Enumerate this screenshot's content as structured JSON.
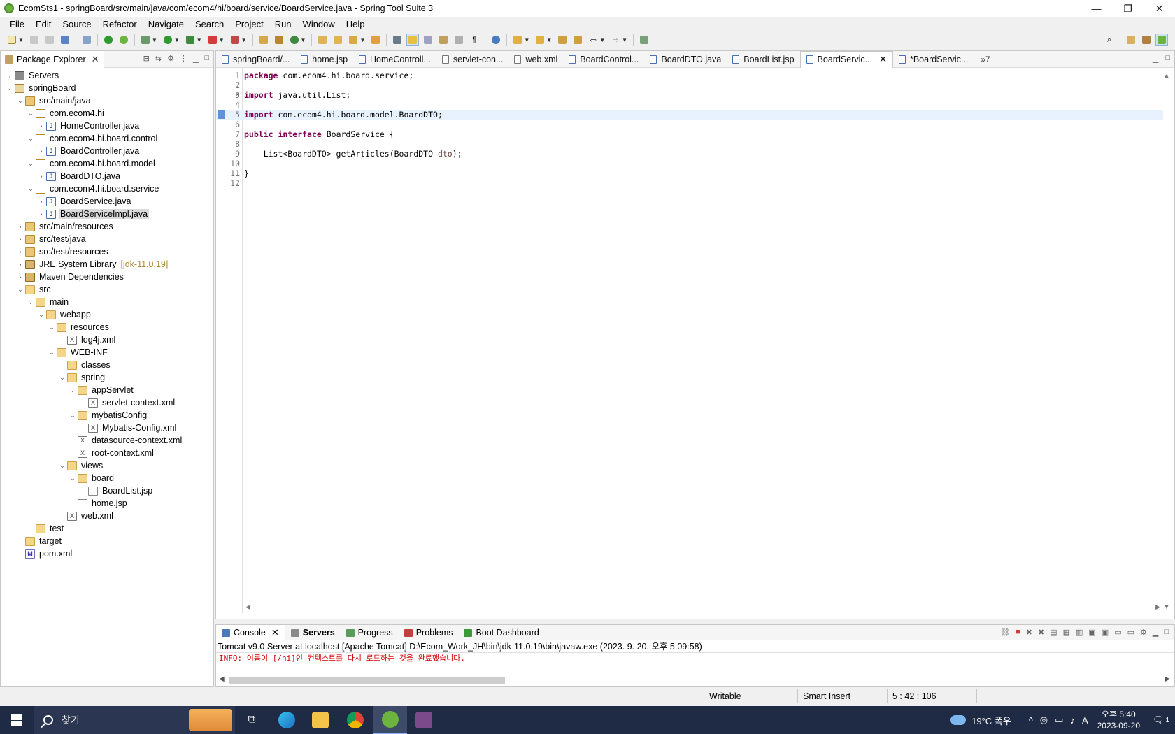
{
  "window": {
    "title": "EcomSts1 - springBoard/src/main/java/com/ecom4/hi/board/service/BoardService.java - Spring Tool Suite 3",
    "min_label": "—",
    "max_label": "❐",
    "close_label": "✕"
  },
  "menu": [
    "File",
    "Edit",
    "Source",
    "Refactor",
    "Navigate",
    "Search",
    "Project",
    "Run",
    "Window",
    "Help"
  ],
  "package_explorer": {
    "tab_label": "Package Explorer",
    "tree": [
      {
        "label": "Servers",
        "icon": "server",
        "depth": 0,
        "twisty": "›"
      },
      {
        "label": "springBoard",
        "icon": "proj",
        "depth": 0,
        "twisty": "⌄"
      },
      {
        "label": "src/main/java",
        "icon": "srcfolder",
        "depth": 1,
        "twisty": "⌄"
      },
      {
        "label": "com.ecom4.hi",
        "icon": "pkg",
        "depth": 2,
        "twisty": "⌄"
      },
      {
        "label": "HomeController.java",
        "icon": "java",
        "depth": 3,
        "twisty": "›"
      },
      {
        "label": "com.ecom4.hi.board.control",
        "icon": "pkg",
        "depth": 2,
        "twisty": "⌄"
      },
      {
        "label": "BoardController.java",
        "icon": "java",
        "depth": 3,
        "twisty": "›"
      },
      {
        "label": "com.ecom4.hi.board.model",
        "icon": "pkg",
        "depth": 2,
        "twisty": "⌄"
      },
      {
        "label": "BoardDTO.java",
        "icon": "java",
        "depth": 3,
        "twisty": "›"
      },
      {
        "label": "com.ecom4.hi.board.service",
        "icon": "pkg",
        "depth": 2,
        "twisty": "⌄"
      },
      {
        "label": "BoardService.java",
        "icon": "java",
        "depth": 3,
        "twisty": "›"
      },
      {
        "label": "BoardServiceImpl.java",
        "icon": "java",
        "depth": 3,
        "twisty": "›",
        "selected": true
      },
      {
        "label": "src/main/resources",
        "icon": "srcfolder",
        "depth": 1,
        "twisty": "›"
      },
      {
        "label": "src/test/java",
        "icon": "srcfolder",
        "depth": 1,
        "twisty": "›"
      },
      {
        "label": "src/test/resources",
        "icon": "srcfolder",
        "depth": 1,
        "twisty": "›"
      },
      {
        "label": "JRE System Library",
        "icon": "lib",
        "depth": 1,
        "twisty": "›",
        "deco": "[jdk-11.0.19]"
      },
      {
        "label": "Maven Dependencies",
        "icon": "lib",
        "depth": 1,
        "twisty": "›"
      },
      {
        "label": "src",
        "icon": "folder",
        "depth": 1,
        "twisty": "⌄"
      },
      {
        "label": "main",
        "icon": "folder",
        "depth": 2,
        "twisty": "⌄"
      },
      {
        "label": "webapp",
        "icon": "folder",
        "depth": 3,
        "twisty": "⌄"
      },
      {
        "label": "resources",
        "icon": "folder",
        "depth": 4,
        "twisty": "⌄"
      },
      {
        "label": "log4j.xml",
        "icon": "xml",
        "depth": 5,
        "twisty": ""
      },
      {
        "label": "WEB-INF",
        "icon": "folder",
        "depth": 4,
        "twisty": "⌄"
      },
      {
        "label": "classes",
        "icon": "folder",
        "depth": 5,
        "twisty": ""
      },
      {
        "label": "spring",
        "icon": "folder",
        "depth": 5,
        "twisty": "⌄"
      },
      {
        "label": "appServlet",
        "icon": "folder",
        "depth": 6,
        "twisty": "⌄"
      },
      {
        "label": "servlet-context.xml",
        "icon": "xml",
        "depth": 7,
        "twisty": ""
      },
      {
        "label": "mybatisConfig",
        "icon": "folder",
        "depth": 6,
        "twisty": "⌄"
      },
      {
        "label": "Mybatis-Config.xml",
        "icon": "xml",
        "depth": 7,
        "twisty": ""
      },
      {
        "label": "datasource-context.xml",
        "icon": "xml",
        "depth": 6,
        "twisty": ""
      },
      {
        "label": "root-context.xml",
        "icon": "xml",
        "depth": 6,
        "twisty": ""
      },
      {
        "label": "views",
        "icon": "folder",
        "depth": 5,
        "twisty": "⌄"
      },
      {
        "label": "board",
        "icon": "folder",
        "depth": 6,
        "twisty": "⌄"
      },
      {
        "label": "BoardList.jsp",
        "icon": "jsp",
        "depth": 7,
        "twisty": ""
      },
      {
        "label": "home.jsp",
        "icon": "jsp",
        "depth": 6,
        "twisty": ""
      },
      {
        "label": "web.xml",
        "icon": "xml",
        "depth": 5,
        "twisty": ""
      },
      {
        "label": "test",
        "icon": "folder",
        "depth": 2,
        "twisty": ""
      },
      {
        "label": "target",
        "icon": "folder",
        "depth": 1,
        "twisty": ""
      },
      {
        "label": "pom.xml",
        "icon": "pom",
        "depth": 1,
        "twisty": ""
      }
    ]
  },
  "editor": {
    "tabs": [
      {
        "label": "springBoard/...",
        "kind": "java"
      },
      {
        "label": "home.jsp",
        "kind": "jsp"
      },
      {
        "label": "HomeControll...",
        "kind": "java"
      },
      {
        "label": "servlet-con...",
        "kind": "xml"
      },
      {
        "label": "web.xml",
        "kind": "xml"
      },
      {
        "label": "BoardControl...",
        "kind": "java"
      },
      {
        "label": "BoardDTO.java",
        "kind": "java"
      },
      {
        "label": "BoardList.jsp",
        "kind": "jsp"
      },
      {
        "label": "BoardServic...",
        "kind": "java",
        "active": true
      },
      {
        "label": "*BoardServic...",
        "kind": "java"
      }
    ],
    "overflow_label": "»7",
    "lines": [
      {
        "n": "1",
        "parts": [
          [
            "kw",
            "package"
          ],
          [
            "",
            " com.ecom4.hi.board.service;"
          ]
        ]
      },
      {
        "n": "2",
        "parts": []
      },
      {
        "n": "3",
        "fold": "⊖",
        "parts": [
          [
            "kw",
            "import"
          ],
          [
            "",
            " java.util.List;"
          ]
        ]
      },
      {
        "n": "4",
        "parts": []
      },
      {
        "n": "5",
        "highlight": true,
        "parts": [
          [
            "kw",
            "import"
          ],
          [
            "",
            " com.ecom4.hi.board.model.BoardDTO;"
          ]
        ]
      },
      {
        "n": "6",
        "parts": []
      },
      {
        "n": "7",
        "parts": [
          [
            "kw",
            "public"
          ],
          [
            "",
            " "
          ],
          [
            "kw",
            "interface"
          ],
          [
            "",
            " BoardService {"
          ]
        ]
      },
      {
        "n": "8",
        "parts": []
      },
      {
        "n": "9",
        "parts": [
          [
            "",
            "    List<BoardDTO> getArticles(BoardDTO "
          ],
          [
            "param",
            "dto"
          ],
          [
            "",
            ");"
          ]
        ]
      },
      {
        "n": "10",
        "parts": []
      },
      {
        "n": "11",
        "parts": [
          [
            "",
            "}"
          ]
        ]
      },
      {
        "n": "12",
        "parts": []
      }
    ]
  },
  "bottom_panel": {
    "tabs": [
      {
        "label": "Console",
        "active": true,
        "color": "#4d7ab8"
      },
      {
        "label": "Servers",
        "bold": true,
        "color": "#8a8a8a"
      },
      {
        "label": "Progress",
        "color": "#5a9a5a"
      },
      {
        "label": "Problems",
        "color": "#c04040"
      },
      {
        "label": "Boot Dashboard",
        "color": "#3a9a3a"
      }
    ],
    "console_description": "Tomcat v9.0 Server at localhost [Apache Tomcat] D:\\Ecom_Work_JH\\bin\\jdk-11.0.19\\bin\\javaw.exe  (2023. 9. 20. 오후 5:09:58)",
    "console_output": "INFO: 이름이 [/hi]인 컨텍스트를 다시 로드하는 것을 완료했습니다."
  },
  "status_bar": {
    "mode": "Writable",
    "insert": "Smart Insert",
    "position": "5 : 42 : 106"
  },
  "taskbar": {
    "search_placeholder": "찾기",
    "weather": "19°C 폭우",
    "time": "오후 5:40",
    "date": "2023-09-20",
    "notification_count": "1"
  },
  "colors": {
    "keyword": "#7f0055",
    "console_error": "#d40000",
    "line_highlight": "#e8f2fe"
  }
}
